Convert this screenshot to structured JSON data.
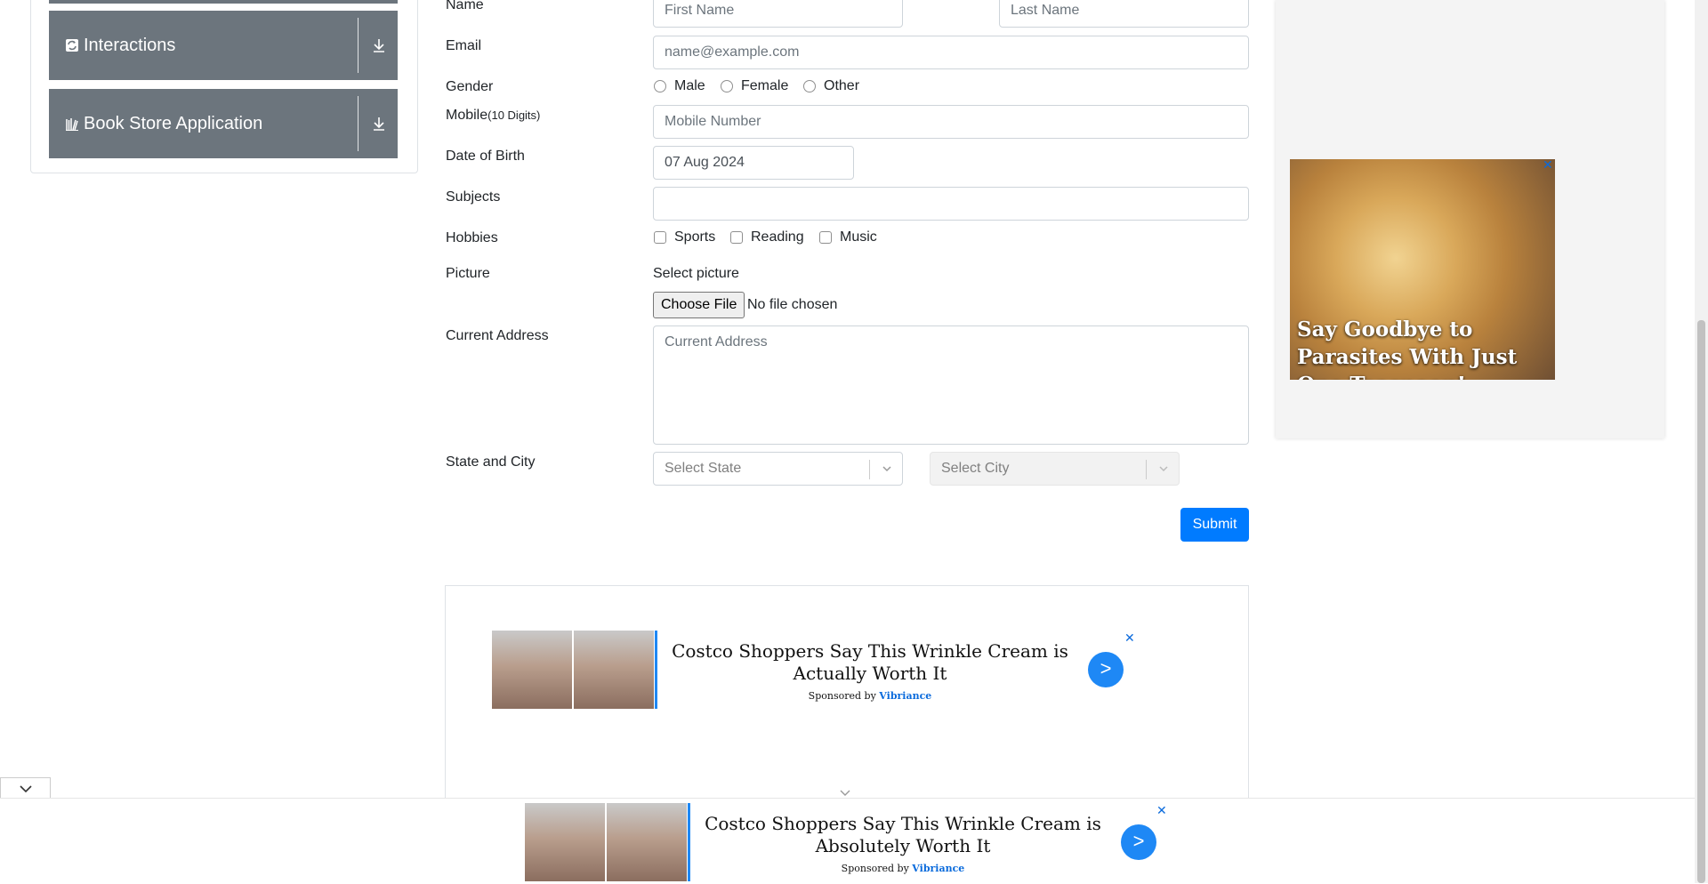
{
  "sidebar": {
    "items": [
      {
        "label": "Interactions",
        "icon": "interactions-icon"
      },
      {
        "label": "Book Store Application",
        "icon": "book-store-icon"
      }
    ]
  },
  "form": {
    "name_label": "Name",
    "first_name_placeholder": "First Name",
    "last_name_placeholder": "Last Name",
    "email_label": "Email",
    "email_placeholder": "name@example.com",
    "gender_label": "Gender",
    "gender_options": [
      "Male",
      "Female",
      "Other"
    ],
    "mobile_label": "Mobile",
    "mobile_hint": "(10 Digits)",
    "mobile_placeholder": "Mobile Number",
    "dob_label": "Date of Birth",
    "dob_value": "07 Aug 2024",
    "subjects_label": "Subjects",
    "hobbies_label": "Hobbies",
    "hobbies_options": [
      "Sports",
      "Reading",
      "Music"
    ],
    "picture_label": "Picture",
    "picture_caption": "Select picture",
    "choose_file_label": "Choose File",
    "no_file_text": "No file chosen",
    "address_label": "Current Address",
    "address_placeholder": "Current Address",
    "state_city_label": "State and City",
    "state_placeholder": "Select State",
    "city_placeholder": "Select City",
    "submit_label": "Submit"
  },
  "ads": {
    "right": {
      "caption": "Say Goodbye to Parasites With Just One Teaspoon!",
      "close": "✕"
    },
    "inline": {
      "title": "Costco Shoppers Say This Wrinkle Cream is Actually Worth It",
      "sponsored_prefix": "Sponsored by",
      "sponsor": "Vibriance",
      "go": ">",
      "close": "✕"
    },
    "bottom": {
      "title": "Costco Shoppers Say This Wrinkle Cream is Absolutely Worth It",
      "sponsored_prefix": "Sponsored by",
      "sponsor": "Vibriance",
      "go": ">",
      "close": "✕"
    }
  },
  "colors": {
    "primary": "#007bff",
    "sidebar_item": "#6c757d",
    "sponsor_link": "#0b6bdc"
  }
}
